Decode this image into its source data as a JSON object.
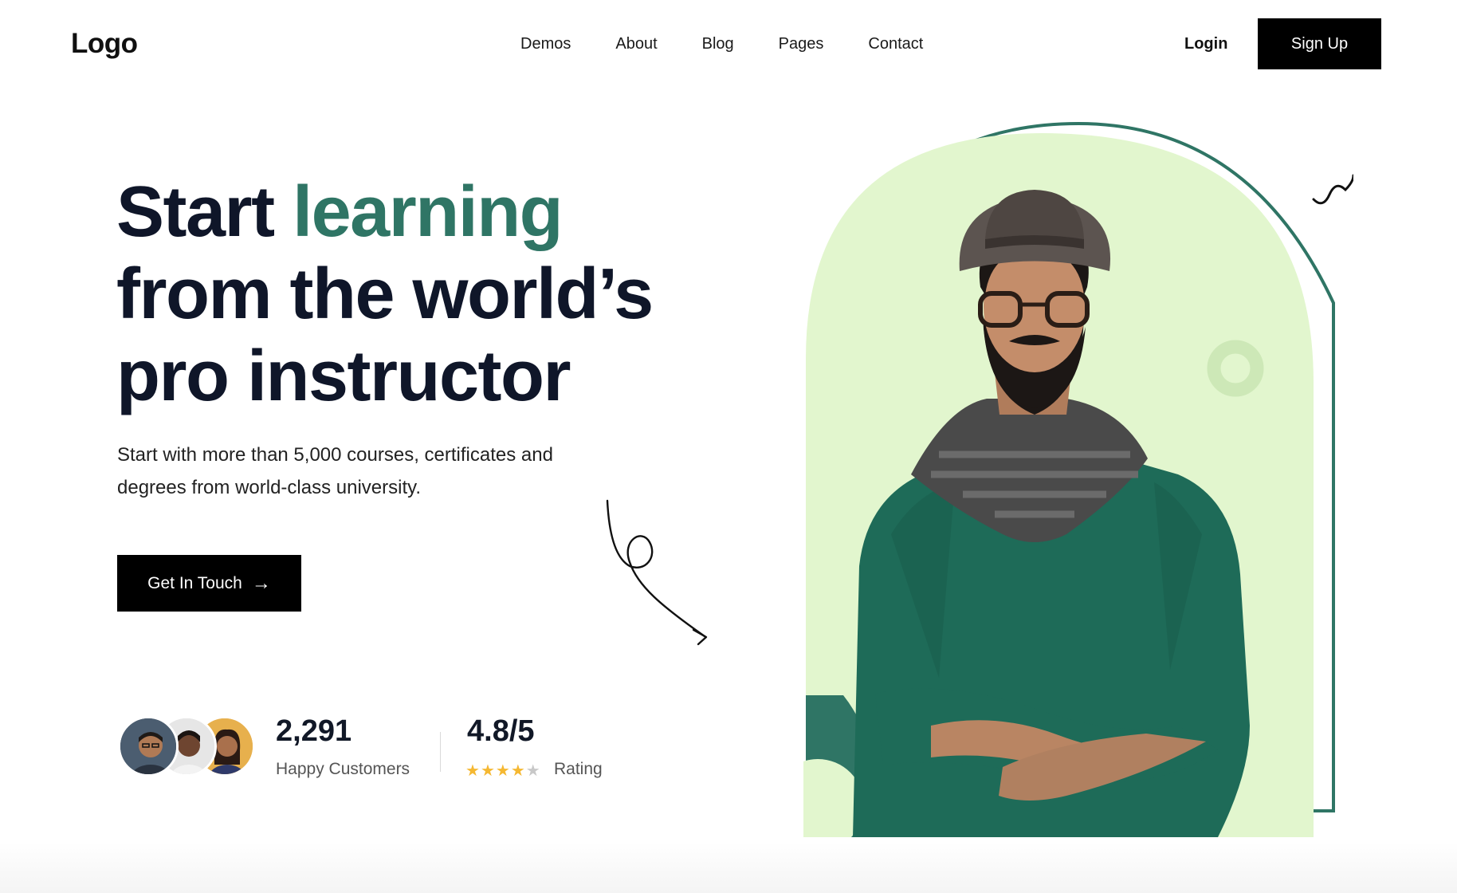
{
  "header": {
    "logo": "Logo",
    "nav": [
      "Demos",
      "About",
      "Blog",
      "Pages",
      "Contact"
    ],
    "login": "Login",
    "signup": "Sign Up"
  },
  "hero": {
    "headline_start": "Start",
    "headline_accent": "learning",
    "headline_line2": "from the world’s",
    "headline_line3": "pro instructor",
    "subtitle": "Start with more than 5,000 courses, certificates and degrees from world-class university.",
    "cta": "Get In Touch"
  },
  "stats": {
    "customers_value": "2,291",
    "customers_label": "Happy Customers",
    "rating_value": "4.8/5",
    "rating_label": "Rating",
    "stars_filled": 4,
    "stars_total": 5
  },
  "colors": {
    "accent": "#2f7565",
    "arch_fill": "#e2f6ce",
    "sweater": "#1e6b58"
  },
  "icons": {
    "cta_arrow": "arrow-right-icon",
    "star": "star-icon"
  }
}
